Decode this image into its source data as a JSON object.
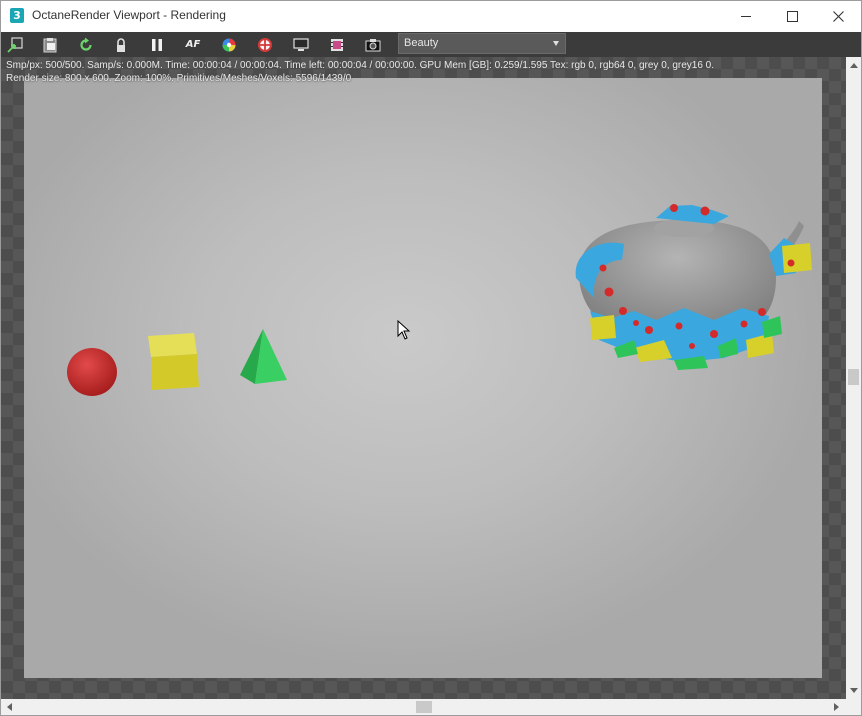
{
  "window": {
    "title": "OctaneRender Viewport - Rendering",
    "app_icon_glyph": "3",
    "controls": [
      "minimize-icon",
      "maximize-icon",
      "close-icon"
    ]
  },
  "toolbar": {
    "buttons": [
      {
        "name": "export-render-button",
        "icon": "export-icon"
      },
      {
        "name": "clipboard-copy-button",
        "icon": "clipboard-icon"
      },
      {
        "name": "restart-render-button",
        "icon": "refresh-icon"
      },
      {
        "name": "lock-viewport-button",
        "icon": "lock-icon"
      },
      {
        "name": "pause-render-button",
        "icon": "pause-icon"
      },
      {
        "name": "auto-focus-button",
        "icon": "af-icon",
        "label": "AF"
      },
      {
        "name": "color-picker-button",
        "icon": "color-wheel-icon"
      },
      {
        "name": "region-render-button",
        "icon": "target-icon"
      },
      {
        "name": "monitor-settings-button",
        "icon": "monitor-icon"
      },
      {
        "name": "film-settings-button",
        "icon": "film-icon"
      },
      {
        "name": "snapshot-button",
        "icon": "camera-icon"
      }
    ],
    "pass_dropdown": {
      "value": "Beauty"
    }
  },
  "render_info": {
    "line1": "Smp/px: 500/500.   Samp/s: 0.000M.   Time: 00:00:04 / 00:00:04.   Time left: 00:00:04 / 00:00:00.   GPU Mem [GB]: 0.259/1.595   Tex: rgb 0, rgb64 0, grey 0, grey16 0.",
    "line2": "Render size: 800 x 600.   Zoom: 100%.   Primitives/Meshes/Voxels: 5596/1439/0"
  },
  "scene": {
    "objects": [
      "red-sphere",
      "yellow-cube",
      "green-pyramid",
      "teapot"
    ],
    "colors": {
      "sphere": "#cc2a2a",
      "cube": "#d7cf2a",
      "pyramid": "#2ec45a",
      "teapot_patch": "#3aa8de",
      "teapot_body": "#9a9a9a"
    }
  },
  "colors": {
    "toolbar_bg": "#3b3b3b",
    "checker_dark": "#4d4d4d",
    "checker_light": "#575757"
  }
}
